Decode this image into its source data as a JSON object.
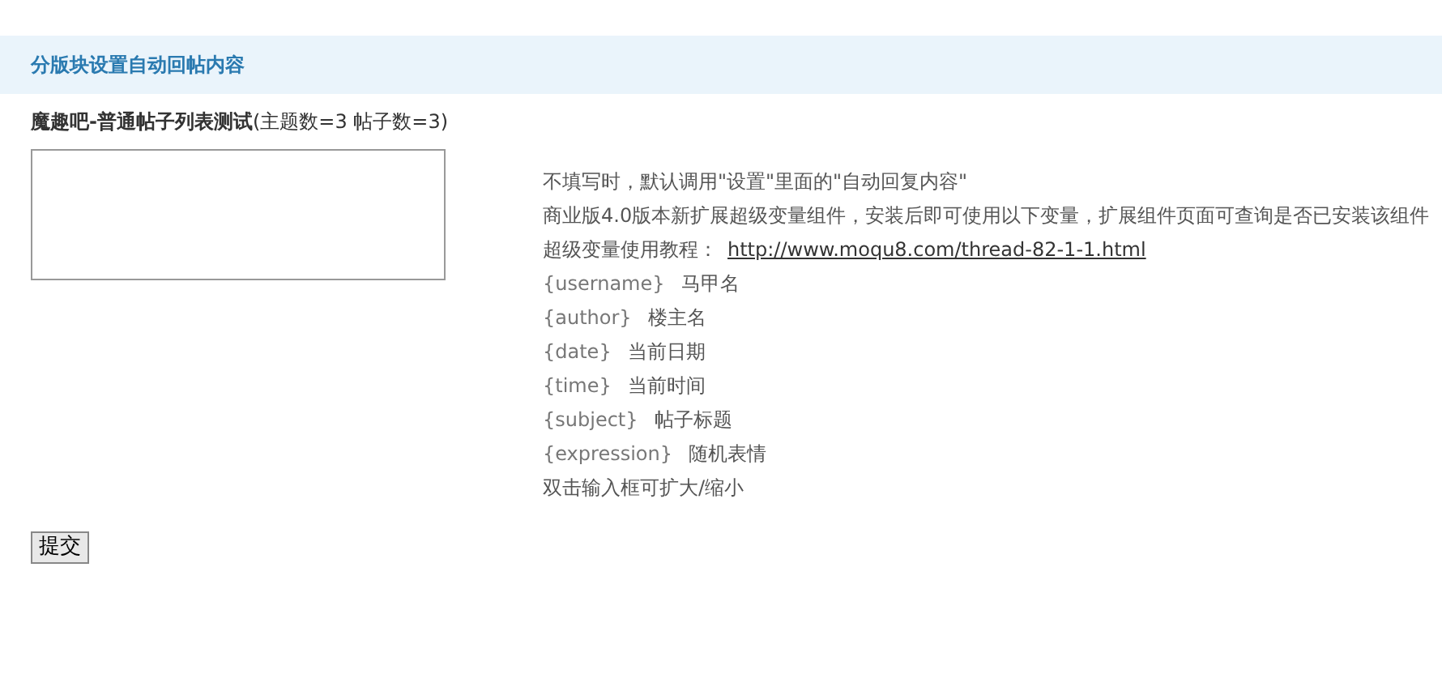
{
  "section_title": "分版块设置自动回帖内容",
  "forum": {
    "name": "魔趣吧-普通帖子列表测试",
    "stats": "(主题数=3  帖子数=3)"
  },
  "help": {
    "lines": [
      "不填写时，默认调用\"设置\"里面的\"自动回复内容\"",
      "商业版4.0版本新扩展超级变量组件，安装后即可使用以下变量，扩展组件页面可查询是否已安装该组件"
    ],
    "tutorial_label": "超级变量使用教程：",
    "tutorial_link": "http://www.moqu8.com/thread-82-1-1.html",
    "variables": [
      {
        "token": "{username}",
        "desc": "马甲名"
      },
      {
        "token": "{author}",
        "desc": "楼主名"
      },
      {
        "token": "{date}",
        "desc": "当前日期"
      },
      {
        "token": "{time}",
        "desc": "当前时间"
      },
      {
        "token": "{subject}",
        "desc": "帖子标题"
      },
      {
        "token": "{expression}",
        "desc": "随机表情"
      }
    ],
    "footer": "双击输入框可扩大/缩小"
  },
  "submit_button": "提交"
}
